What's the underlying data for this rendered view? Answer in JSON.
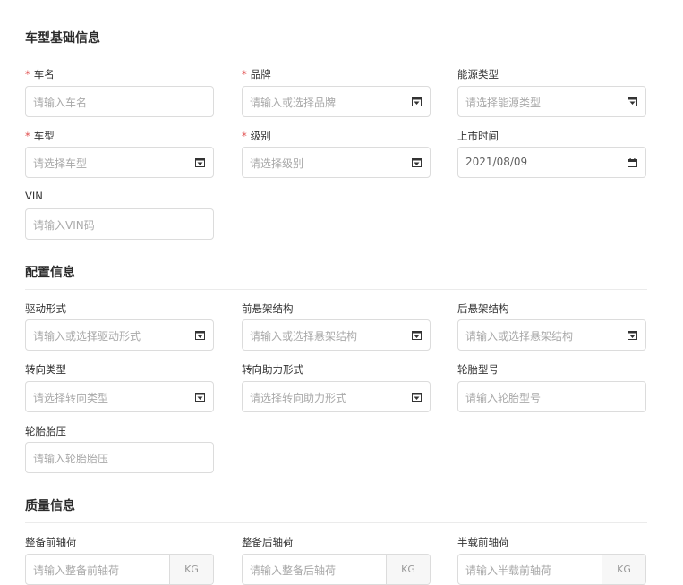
{
  "sections": {
    "basic": "车型基础信息",
    "config": "配置信息",
    "quality": "质量信息"
  },
  "basic": {
    "car_name": {
      "label": "车名",
      "required": "*",
      "placeholder": "请输入车名"
    },
    "brand": {
      "label": "品牌",
      "required": "*",
      "placeholder": "请输入或选择品牌"
    },
    "energy_type": {
      "label": "能源类型",
      "placeholder": "请选择能源类型"
    },
    "model": {
      "label": "车型",
      "required": "*",
      "placeholder": "请选择车型"
    },
    "level": {
      "label": "级别",
      "required": "*",
      "placeholder": "请选择级别"
    },
    "launch_time": {
      "label": "上市时间",
      "value": "2021/08/09"
    },
    "vin": {
      "label": "VIN",
      "placeholder": "请输入VIN码"
    }
  },
  "config": {
    "drive_form": {
      "label": "驱动形式",
      "placeholder": "请输入或选择驱动形式"
    },
    "front_suspension": {
      "label": "前悬架结构",
      "placeholder": "请输入或选择悬架结构"
    },
    "rear_suspension": {
      "label": "后悬架结构",
      "placeholder": "请输入或选择悬架结构"
    },
    "steering_type": {
      "label": "转向类型",
      "placeholder": "请选择转向类型"
    },
    "power_steering": {
      "label": "转向助力形式",
      "placeholder": "请选择转向助力形式"
    },
    "tire_model": {
      "label": "轮胎型号",
      "placeholder": "请输入轮胎型号"
    },
    "tire_pressure": {
      "label": "轮胎胎压",
      "placeholder": "请输入轮胎胎压"
    }
  },
  "quality": {
    "curb_front_axle": {
      "label": "整备前轴荷",
      "placeholder": "请输入整备前轴荷",
      "unit": "KG"
    },
    "curb_rear_axle": {
      "label": "整备后轴荷",
      "placeholder": "请输入整备后轴荷",
      "unit": "KG"
    },
    "half_front_axle": {
      "label": "半载前轴荷",
      "placeholder": "请输入半载前轴荷",
      "unit": "KG"
    }
  },
  "icons": {
    "dropdown": "dropdown-arrow-icon",
    "calendar": "calendar-icon"
  },
  "colors": {
    "required": "#e04b4b",
    "border": "#dcdcdc",
    "placeholder": "#a9a9a9"
  }
}
